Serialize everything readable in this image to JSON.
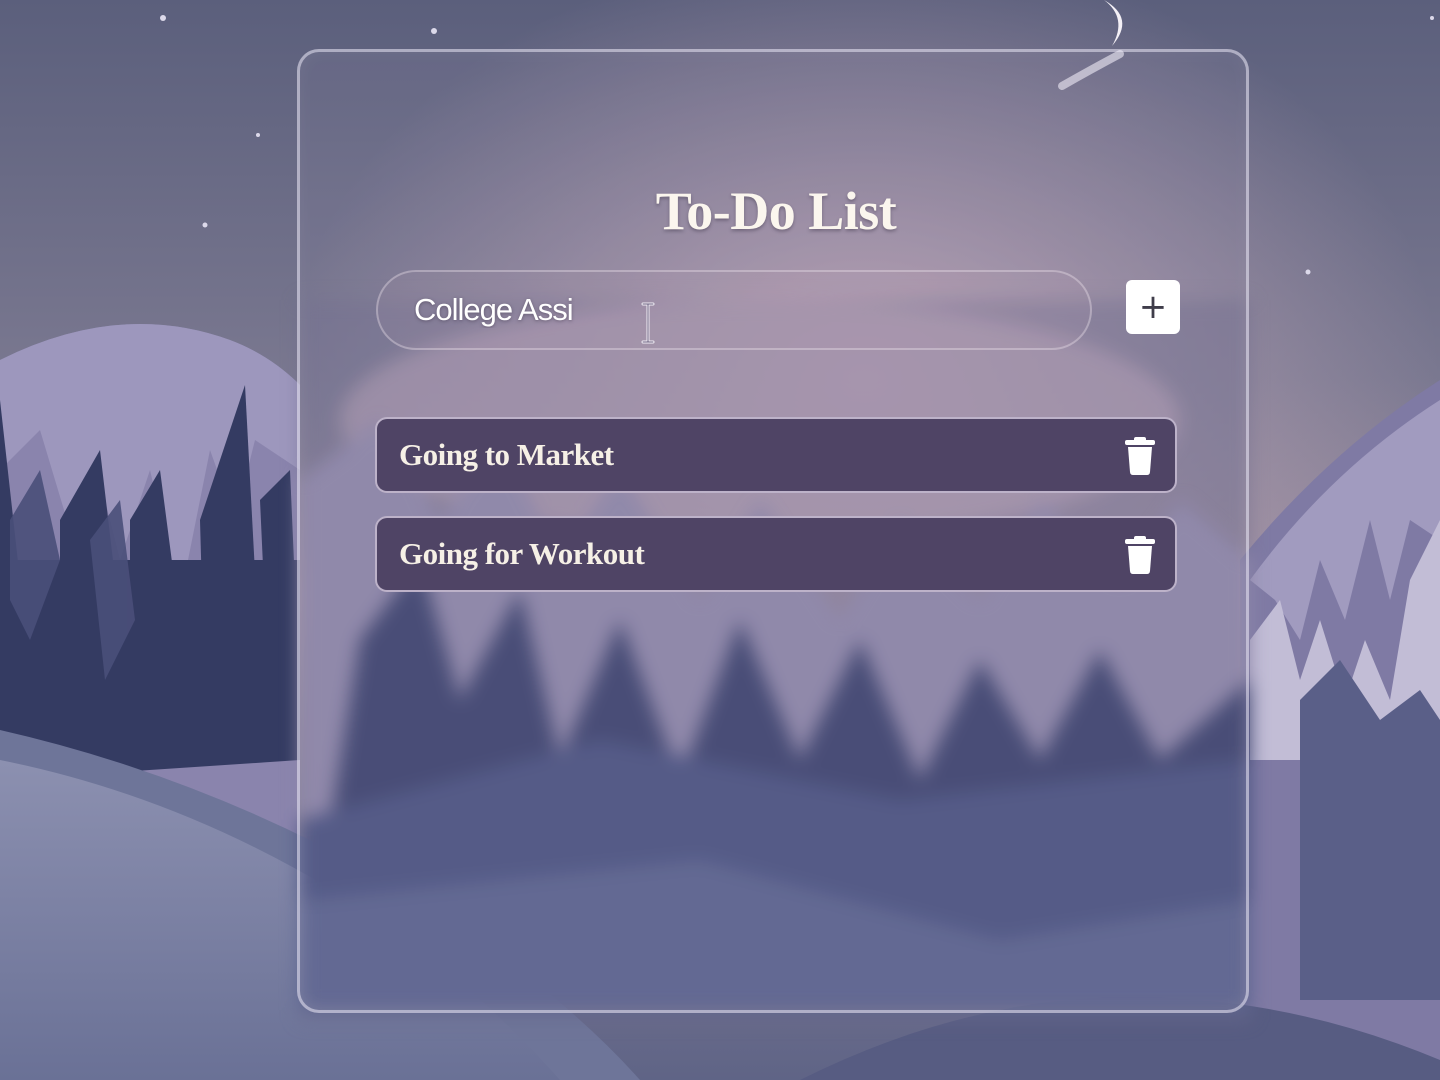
{
  "app": {
    "title": "To-Do List"
  },
  "input": {
    "value": "College Assi",
    "placeholder": ""
  },
  "add_button": {
    "label": "+"
  },
  "todos": [
    {
      "text": "Going to Market"
    },
    {
      "text": "Going for Workout"
    }
  ],
  "icons": {
    "add": "plus-icon",
    "delete": "trash-icon",
    "cursor": "text-cursor-icon",
    "moon": "crescent-moon"
  },
  "colors": {
    "sky": "#6f7190",
    "todo_item": "#4f4465",
    "title_text": "#fbf6ee",
    "button_bg": "#ffffff"
  }
}
